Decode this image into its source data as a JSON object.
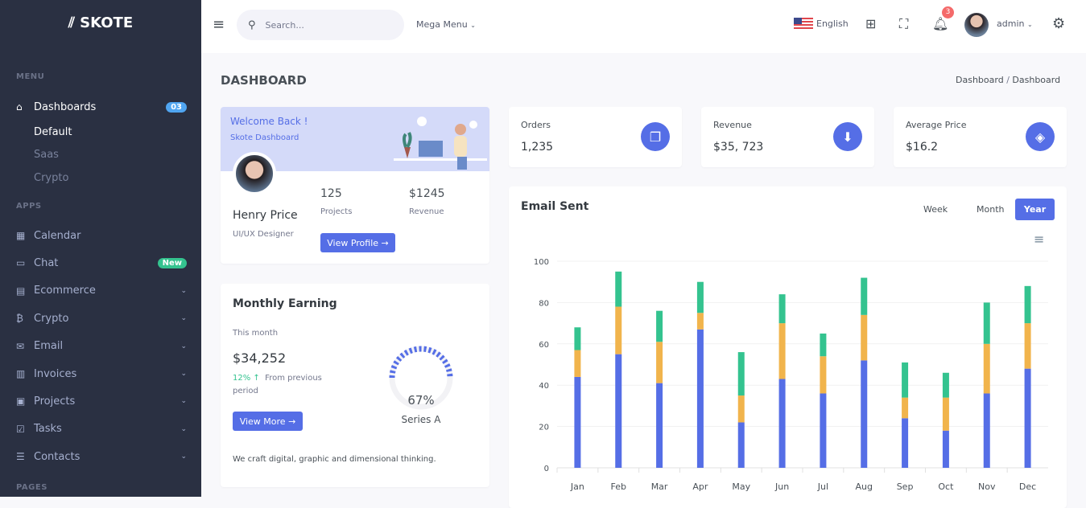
{
  "brand": {
    "name": "SKOTE"
  },
  "sidebar": {
    "sections": [
      "MENU",
      "APPS",
      "PAGES"
    ],
    "dashboards": {
      "label": "Dashboards",
      "badge": "03",
      "sub": [
        "Default",
        "Saas",
        "Crypto"
      ]
    },
    "items": [
      {
        "label": "Calendar",
        "icon": "calendar-icon"
      },
      {
        "label": "Chat",
        "icon": "chat-icon",
        "badge": "New"
      },
      {
        "label": "Ecommerce",
        "icon": "store-icon",
        "chevron": true
      },
      {
        "label": "Crypto",
        "icon": "bitcoin-icon",
        "chevron": true
      },
      {
        "label": "Email",
        "icon": "envelope-icon",
        "chevron": true
      },
      {
        "label": "Invoices",
        "icon": "receipt-icon",
        "chevron": true
      },
      {
        "label": "Projects",
        "icon": "briefcase-icon",
        "chevron": true
      },
      {
        "label": "Tasks",
        "icon": "task-icon",
        "chevron": true
      },
      {
        "label": "Contacts",
        "icon": "contacts-icon",
        "chevron": true
      }
    ]
  },
  "topbar": {
    "search_placeholder": "Search...",
    "mega_menu": "Mega Menu",
    "language": "English",
    "notifications": "3",
    "user": "admin"
  },
  "page": {
    "title": "DASHBOARD",
    "breadcrumb": [
      "Dashboard",
      "Dashboard"
    ]
  },
  "welcome": {
    "title": "Welcome Back !",
    "subtitle": "Skote Dashboard",
    "name": "Henry Price",
    "role": "UI/UX Designer",
    "projects_value": "125",
    "projects_label": "Projects",
    "revenue_value": "$1245",
    "revenue_label": "Revenue",
    "button": "View Profile"
  },
  "earning": {
    "title": "Monthly Earning",
    "period": "This month",
    "amount": "$34,252",
    "change": "12%",
    "change_text": "From previous period",
    "button": "View More",
    "footer": "We craft digital, graphic and dimensional thinking.",
    "radial_percent": 67,
    "radial_label": "67%",
    "radial_series": "Series A"
  },
  "stats": [
    {
      "label": "Orders",
      "value": "1,235",
      "icon": "copy-icon"
    },
    {
      "label": "Revenue",
      "value": "$35, 723",
      "icon": "archive-download-icon"
    },
    {
      "label": "Average Price",
      "value": "$16.2",
      "icon": "tag-icon"
    }
  ],
  "email_chart": {
    "title": "Email Sent",
    "tabs": [
      "Week",
      "Month",
      "Year"
    ],
    "active_tab": "Year"
  },
  "chart_data": {
    "type": "bar",
    "stacked": true,
    "categories": [
      "Jan",
      "Feb",
      "Mar",
      "Apr",
      "May",
      "Jun",
      "Jul",
      "Aug",
      "Sep",
      "Oct",
      "Nov",
      "Dec"
    ],
    "series": [
      {
        "values": [
          44,
          55,
          41,
          67,
          22,
          43,
          36,
          52,
          24,
          18,
          36,
          48
        ],
        "color": "#556ee6"
      },
      {
        "values": [
          13,
          23,
          20,
          8,
          13,
          27,
          18,
          22,
          10,
          16,
          24,
          22
        ],
        "color": "#f1b44c"
      },
      {
        "values": [
          11,
          17,
          15,
          15,
          21,
          14,
          11,
          18,
          17,
          12,
          20,
          18
        ],
        "color": "#34c38f"
      }
    ],
    "ylim": [
      0,
      100
    ],
    "yticks": [
      0,
      20,
      40,
      60,
      80,
      100
    ],
    "grid": true
  },
  "colors": {
    "sidebar": "#2a3042",
    "accent": "#556ee6",
    "success": "#34c38f",
    "warning": "#f1b44c",
    "danger": "#f46a6a"
  }
}
